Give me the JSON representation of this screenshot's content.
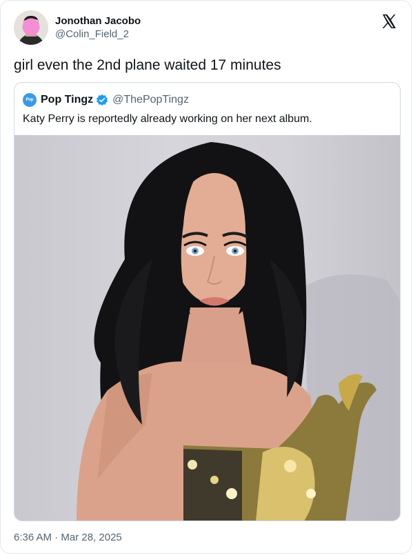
{
  "tweet": {
    "author": {
      "display_name": "Jonothan Jacobo",
      "handle": "@Colin_Field_2",
      "avatar_icon": "user-avatar"
    },
    "text": "girl even the 2nd plane waited 17 minutes",
    "timestamp": "6:36 AM · Mar 28, 2025",
    "platform_icon": "x-logo-icon"
  },
  "quoted_tweet": {
    "author": {
      "display_name": "Pop Tingz",
      "handle": "@ThePopTingz",
      "avatar_text": "Pop",
      "verified": true,
      "verified_color": "#1d9bf0"
    },
    "text": "Katy Perry is reportedly already working on her next album.",
    "media": {
      "type": "photo",
      "description_icon": "portrait-photo"
    }
  },
  "colors": {
    "text_primary": "#0f1419",
    "text_secondary": "#536471",
    "border": "#cfd9de",
    "verified_blue": "#1d9bf0"
  }
}
